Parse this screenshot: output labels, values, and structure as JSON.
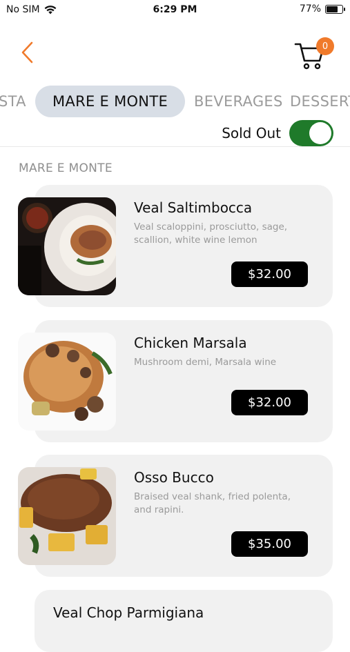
{
  "status_bar": {
    "carrier": "No SIM",
    "time": "6:29 PM",
    "battery": "77%",
    "battery_level": 0.77
  },
  "header": {
    "cart_count": "0",
    "accent_color": "#f07a2b"
  },
  "tabs": [
    "STA",
    "MARE E MONTE",
    "BEVERAGES",
    "DESSERTS"
  ],
  "active_tab": "MARE E MONTE",
  "filter": {
    "sold_out_label": "Sold Out",
    "sold_out_on": true
  },
  "section": {
    "title": "MARE E MONTE"
  },
  "items": [
    {
      "name": "Veal Saltimbocca",
      "description": "Veal scaloppini, prosciutto, sage, scallion, white wine lemon",
      "price": "$32.00"
    },
    {
      "name": "Chicken Marsala",
      "description": "Mushroom demi, Marsala wine",
      "price": "$32.00"
    },
    {
      "name": "Osso Bucco",
      "description": "Braised veal shank, fried polenta, and rapini.",
      "price": "$35.00"
    },
    {
      "name": "Veal Chop Parmigiana"
    }
  ]
}
